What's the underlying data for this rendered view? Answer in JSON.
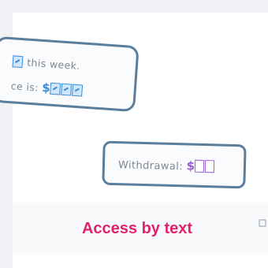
{
  "balloon_top": {
    "line1_text": "this week.",
    "line2_text": "ce is:",
    "dollar": "$"
  },
  "balloon_bottom": {
    "label": "Withdrawal:",
    "dollar": "$"
  },
  "caption": "Access by text",
  "colors": {
    "balloon_border": "#5b7e9c",
    "text_gray": "#7e8791",
    "blue_accent": "#3f8bd6",
    "purple_accent": "#9c5bd6",
    "caption_pink": "#e0226e"
  }
}
